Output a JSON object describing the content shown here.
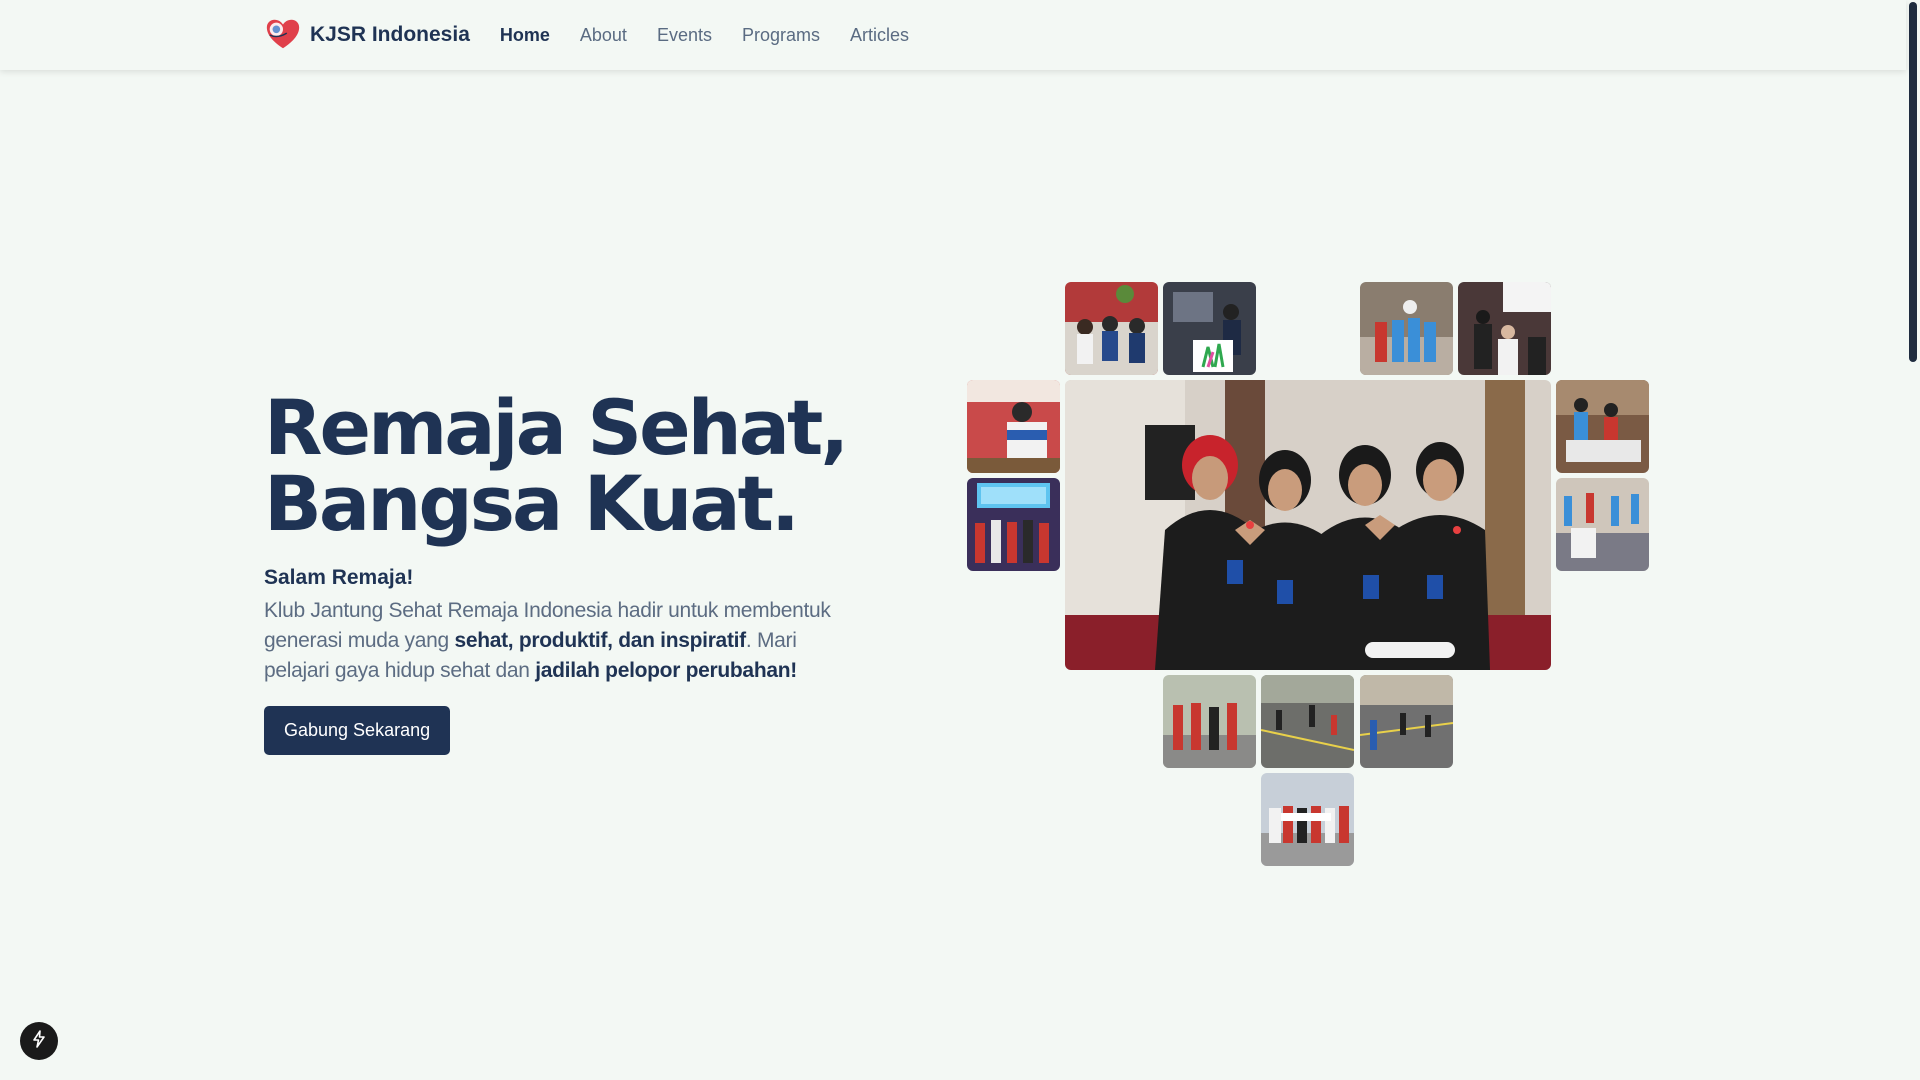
{
  "nav": {
    "brand": "KJSR Indonesia",
    "links": [
      {
        "label": "Home",
        "active": true
      },
      {
        "label": "About"
      },
      {
        "label": "Events"
      },
      {
        "label": "Programs"
      },
      {
        "label": "Articles"
      }
    ]
  },
  "hero": {
    "title_line1": "Remaja Sehat,",
    "title_line2": "Bangsa Kuat.",
    "greeting": "Salam Remaja!",
    "desc_part1": "Klub Jantung Sehat Remaja Indonesia hadir untuk membentuk generasi muda yang ",
    "desc_bold1": "sehat, produktif, dan inspiratif",
    "desc_part2": ". Mari pelajari gaya hidup sehat dan ",
    "desc_bold2": "jadilah pelopor perubahan!",
    "cta_label": "Gabung Sekarang"
  },
  "colors": {
    "background": "#f3f8f4",
    "navy": "#1f3354",
    "muted_text": "#5c6c82",
    "heart_red": "#e0404a"
  },
  "icons": {
    "brand_logo": "heart-logo-icon",
    "fab": "lightning-icon"
  },
  "gallery": {
    "photos": [
      "photo-seated-group",
      "photo-stage-drawing",
      "photo-blue-team-trophy",
      "photo-speaker-presentation",
      "photo-blue-uniform-student",
      "photo-main-heart-hands",
      "photo-classroom-activity",
      "photo-screen-stage-group",
      "photo-floor-sitting-group",
      "photo-outdoor-red-group",
      "photo-court-game-1",
      "photo-court-game-2",
      "photo-group-banner-outdoor"
    ]
  }
}
